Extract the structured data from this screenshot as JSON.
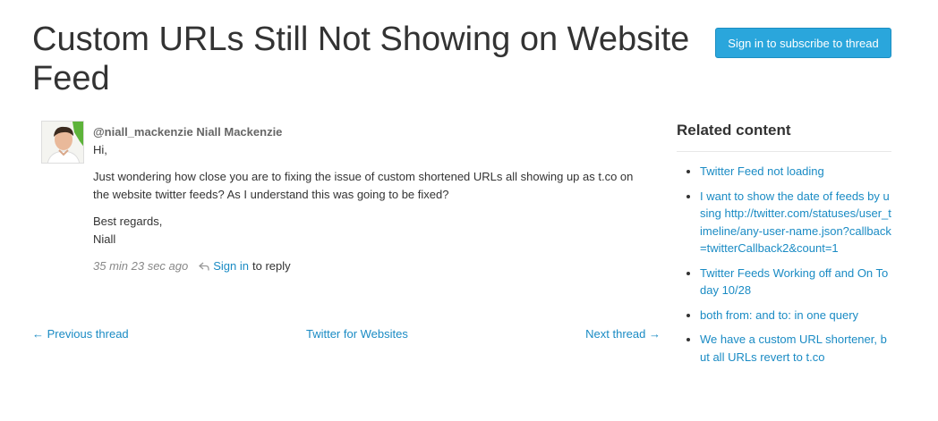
{
  "page": {
    "title": "Custom URLs Still Not Showing on Website Feed",
    "subscribe_label": "Sign in to subscribe to thread"
  },
  "post": {
    "handle": "@niall_mackenzie",
    "name": "Niall Mackenzie",
    "greeting": "Hi,",
    "body": "Just wondering how close you are to fixing the issue of custom shortened URLs all showing up as t.co on the website twitter feeds? As I understand this was going to be fixed?",
    "closing": "Best regards,",
    "signature": "Niall",
    "time": "35 min 23 sec ago",
    "signin_label": "Sign in",
    "reply_suffix": "to reply"
  },
  "thread_nav": {
    "previous": "← Previous thread",
    "category": "Twitter for Websites",
    "next": "Next thread →"
  },
  "related": {
    "heading": "Related content",
    "items": [
      "Twitter Feed not loading",
      "I want to show the date of feeds by using http://twitter.com/statuses/user_timeline/any-user-name.json?callback=twitterCallback2&count=1",
      "Twitter Feeds Working off and On Today 10/28",
      "both from: and to: in one query",
      "We have a custom URL shortener, but all URLs revert to t.co"
    ]
  },
  "colors": {
    "link": "#1a8bc4",
    "button": "#2aa6dc"
  },
  "icons": {
    "reply": "reply-arrow-icon",
    "avatar": "user-avatar"
  }
}
